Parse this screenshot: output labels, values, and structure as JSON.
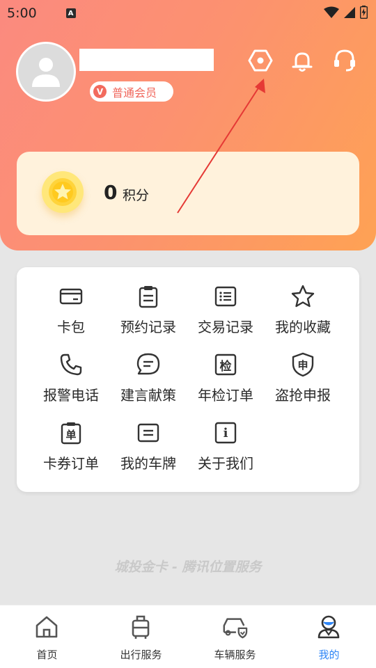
{
  "status_bar": {
    "time": "5:00",
    "notification_glyph": "A"
  },
  "header": {
    "member_badge_letter": "V",
    "member_level": "普通会员",
    "icons": [
      "settings-icon",
      "bell-icon",
      "headset-icon"
    ]
  },
  "points": {
    "value": "0",
    "label": "积分"
  },
  "menu": {
    "items": [
      {
        "label": "卡包",
        "icon": "wallet-icon"
      },
      {
        "label": "预约记录",
        "icon": "clipboard-icon"
      },
      {
        "label": "交易记录",
        "icon": "list-icon"
      },
      {
        "label": "我的收藏",
        "icon": "star-icon"
      },
      {
        "label": "报警电话",
        "icon": "phone-icon"
      },
      {
        "label": "建言献策",
        "icon": "chat-icon"
      },
      {
        "label": "年检订单",
        "icon": "inspection-icon",
        "glyph": "检"
      },
      {
        "label": "盗抢申报",
        "icon": "shield-icon",
        "glyph": "申"
      },
      {
        "label": "卡券订单",
        "icon": "coupon-order-icon",
        "glyph": "单"
      },
      {
        "label": "我的车牌",
        "icon": "license-plate-icon"
      },
      {
        "label": "关于我们",
        "icon": "info-icon",
        "glyph": "i"
      }
    ]
  },
  "footer": {
    "text": "城投金卡 - 腾讯位置服务"
  },
  "tabbar": {
    "active_index": 3,
    "active_color": "#2f86f6",
    "tabs": [
      {
        "label": "首页",
        "icon": "home-icon"
      },
      {
        "label": "出行服务",
        "icon": "luggage-icon"
      },
      {
        "label": "车辆服务",
        "icon": "car-service-icon"
      },
      {
        "label": "我的",
        "icon": "profile-icon"
      }
    ]
  },
  "colors": {
    "hero_gradient_start": "#fb8a7f",
    "hero_gradient_end": "#fea254",
    "annotation_arrow": "#e53935",
    "points_card_bg": "#fff2dc"
  }
}
